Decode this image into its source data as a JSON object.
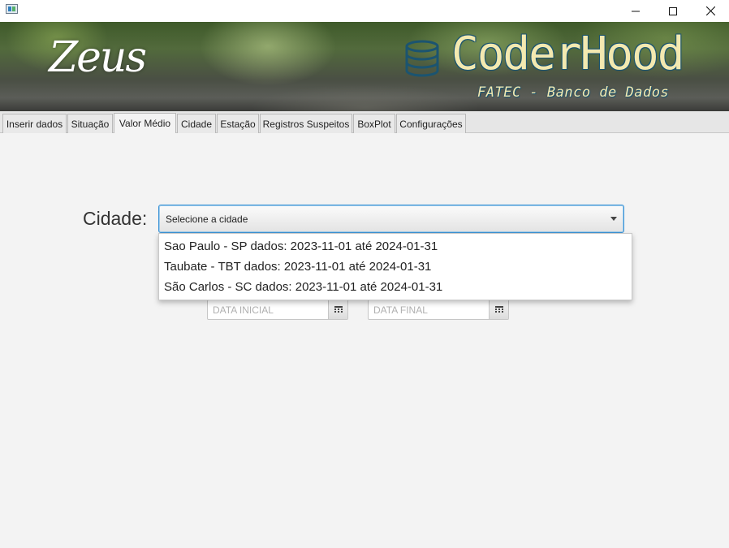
{
  "window": {
    "icons": [
      "app-icon",
      "minimize-icon",
      "maximize-icon",
      "close-icon"
    ]
  },
  "banner": {
    "left_text": "Zeus",
    "brand": "CoderHood",
    "subtitle": "FATEC - Banco de Dados",
    "brand_color": "#f3e9b0",
    "outline_color": "#1b5470",
    "icon": "database-icon"
  },
  "tabs": [
    {
      "label": "Inserir dados",
      "active": false
    },
    {
      "label": "Situação",
      "active": false
    },
    {
      "label": "Valor Médio",
      "active": true
    },
    {
      "label": "Cidade",
      "active": false
    },
    {
      "label": "Estação",
      "active": false
    },
    {
      "label": "Registros Suspeitos",
      "active": false
    },
    {
      "label": "BoxPlot",
      "active": false
    },
    {
      "label": "Configurações",
      "active": false
    }
  ],
  "form": {
    "cidade_label": "Cidade:",
    "cidade_placeholder": "Selecione a cidade",
    "data_inicial_placeholder": "DATA INICIAL",
    "data_final_placeholder": "DATA FINAL",
    "calendar_icon": "calendar-icon",
    "accent_color": "#3a93d6"
  },
  "dropdown": {
    "options": [
      "Sao Paulo - SP dados: 2023-11-01 até 2024-01-31",
      "Taubate - TBT dados: 2023-11-01 até 2024-01-31",
      "São Carlos - SC dados: 2023-11-01 até 2024-01-31"
    ]
  }
}
